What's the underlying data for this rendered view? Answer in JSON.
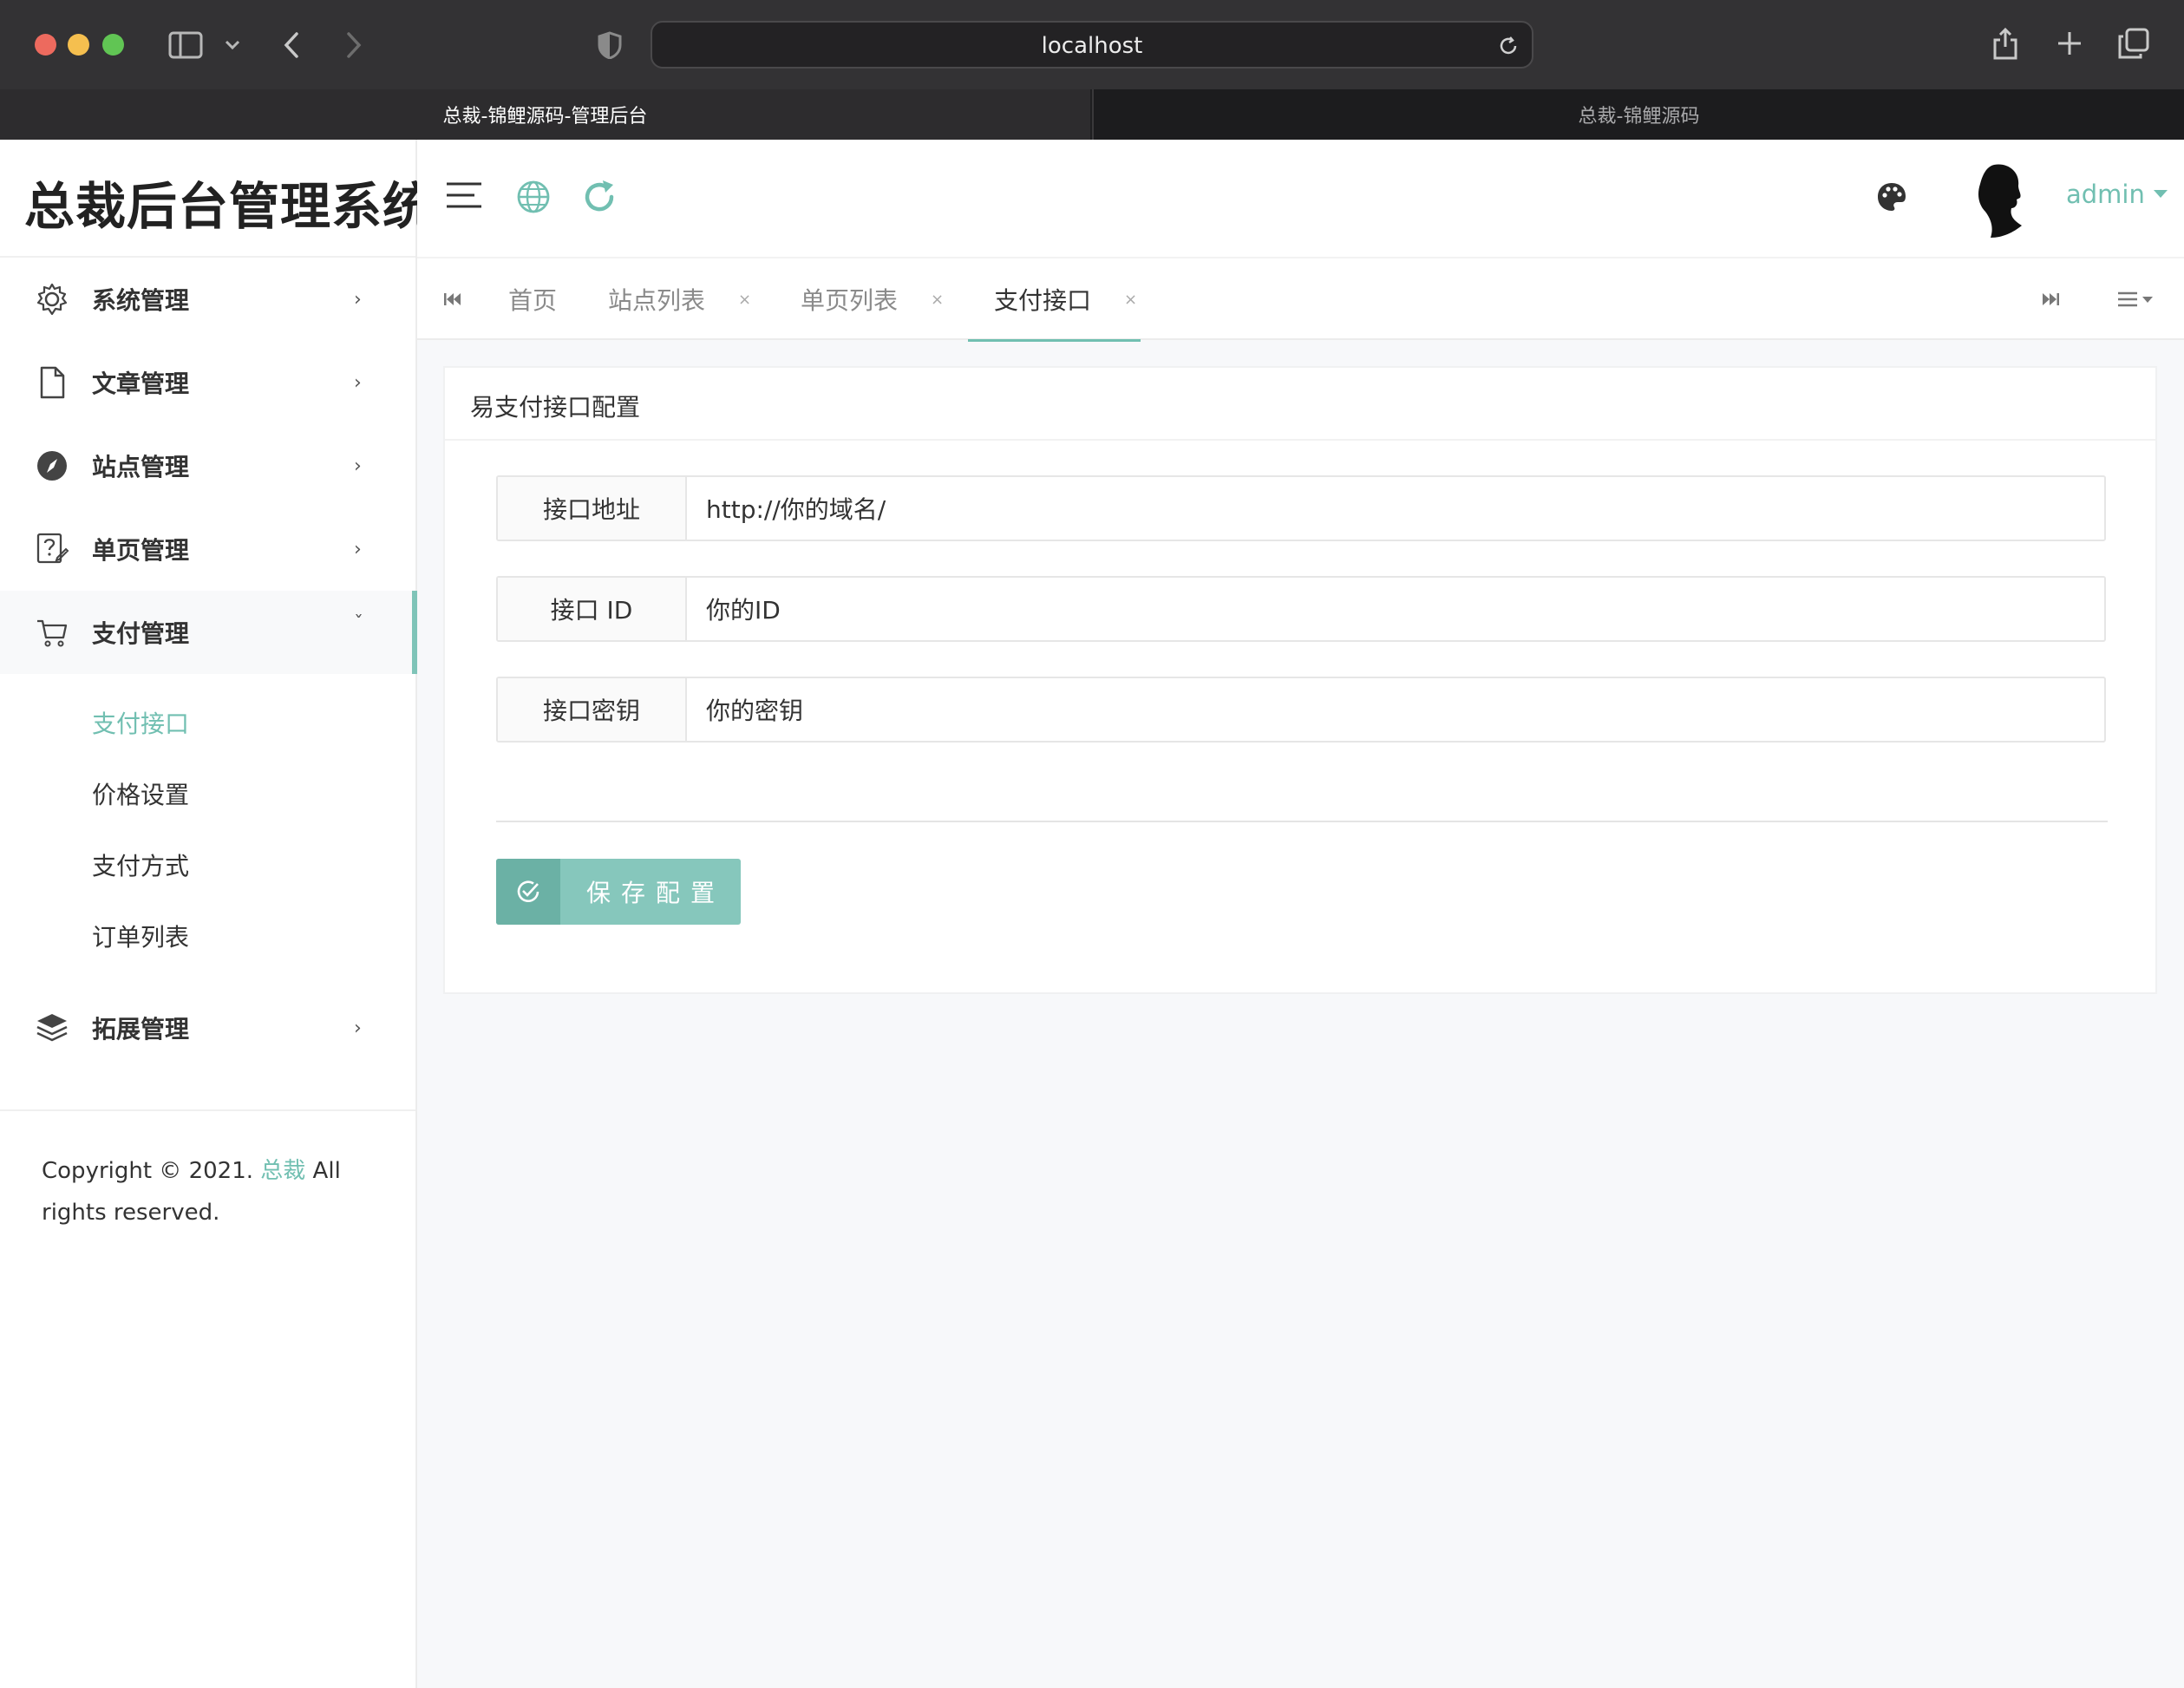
{
  "browser": {
    "url": "localhost",
    "tabs": [
      {
        "label": "总裁-锦鲤源码-管理后台"
      },
      {
        "label": "总裁-锦鲤源码"
      }
    ]
  },
  "sidebar": {
    "logo": "总裁后台管理系统",
    "menu": [
      {
        "label": "系统管理",
        "icon": "gear-icon"
      },
      {
        "label": "文章管理",
        "icon": "document-icon"
      },
      {
        "label": "站点管理",
        "icon": "compass-icon"
      },
      {
        "label": "单页管理",
        "icon": "help-edit-icon"
      },
      {
        "label": "支付管理",
        "icon": "cart-icon"
      },
      {
        "label": "拓展管理",
        "icon": "layers-icon"
      }
    ],
    "submenu": [
      {
        "label": "支付接口"
      },
      {
        "label": "价格设置"
      },
      {
        "label": "支付方式"
      },
      {
        "label": "订单列表"
      }
    ],
    "copyright": {
      "prefix": "Copyright © 2021. ",
      "brand": "总裁",
      "suffix": " All rights reserved."
    }
  },
  "header": {
    "user": "admin"
  },
  "page_tabs": [
    {
      "label": "首页",
      "closable": false
    },
    {
      "label": "站点列表",
      "closable": true
    },
    {
      "label": "单页列表",
      "closable": true
    },
    {
      "label": "支付接口",
      "closable": true,
      "active": true
    }
  ],
  "close_glyph": "×",
  "card": {
    "title": "易支付接口配置",
    "fields": [
      {
        "label": "接口地址",
        "value": "http://你的域名/"
      },
      {
        "label": "接口 ID",
        "value": "你的ID"
      },
      {
        "label": "接口密钥",
        "value": "你的密钥"
      }
    ],
    "save_label": "保存配置"
  },
  "colors": {
    "accent": "#71bfb1",
    "accent_dark": "#6bb1a5"
  }
}
